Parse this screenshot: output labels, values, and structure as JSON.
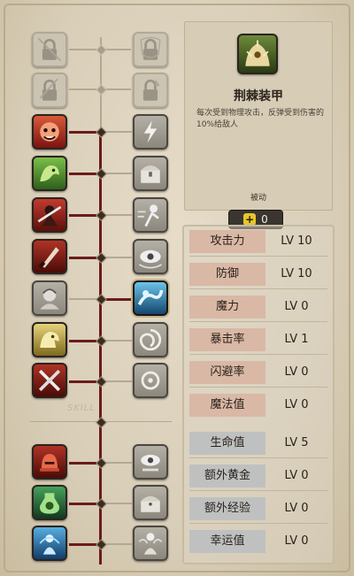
{
  "colors": {
    "background": "#ddd4c1",
    "tree_line": "#6a1b1b",
    "attack_stat_bg": "#d9b8a6",
    "support_stat_bg": "#bfc1c0",
    "points_badge": "#3b3530",
    "plus_icon": "#e7c62d"
  },
  "tree": {
    "left_column": [
      {
        "icon": "locked-sword-icon",
        "state": "locked"
      },
      {
        "icon": "locked-scroll-icon",
        "state": "locked"
      },
      {
        "icon": "red-demon-icon",
        "state": "unlocked"
      },
      {
        "icon": "green-beast-icon",
        "state": "unlocked"
      },
      {
        "icon": "dark-warrior-icon",
        "state": "unlocked"
      },
      {
        "icon": "blade-strike-icon",
        "state": "unlocked"
      },
      {
        "icon": "grey-knight-icon",
        "state": "inactive"
      },
      {
        "icon": "golden-dragon-icon",
        "state": "unlocked"
      },
      {
        "icon": "crossed-swords-icon",
        "state": "unlocked"
      },
      {
        "icon": "red-helmet-icon",
        "state": "unlocked"
      },
      {
        "icon": "green-potion-icon",
        "state": "unlocked"
      },
      {
        "icon": "blue-spirit-icon",
        "state": "unlocked"
      }
    ],
    "right_column": [
      {
        "icon": "locked-shield-icon",
        "state": "locked"
      },
      {
        "icon": "locked-axe-icon",
        "state": "locked"
      },
      {
        "icon": "lightning-fist-icon",
        "state": "inactive"
      },
      {
        "icon": "chest-icon",
        "state": "inactive"
      },
      {
        "icon": "dash-icon",
        "state": "inactive"
      },
      {
        "icon": "wind-eye-icon",
        "state": "inactive"
      },
      {
        "icon": "blue-wave-icon",
        "state": "unlocked"
      },
      {
        "icon": "swirl-icon",
        "state": "inactive"
      },
      {
        "icon": "ring-burst-icon",
        "state": "inactive"
      },
      {
        "icon": "eye-orb-icon",
        "state": "inactive"
      },
      {
        "icon": "treasure-icon",
        "state": "inactive"
      },
      {
        "icon": "angel-icon",
        "state": "inactive"
      }
    ],
    "section_label": "SKILL"
  },
  "detail": {
    "icon": "thorn-armor-icon",
    "title": "荆棘装甲",
    "description": "每次受到物理攻击，反弹受到伤害的10%给敌人",
    "type": "被动"
  },
  "points": {
    "value": "0"
  },
  "stats": [
    {
      "name": "攻击力",
      "level": "LV 10",
      "group": "attack"
    },
    {
      "name": "防御",
      "level": "LV 10",
      "group": "attack"
    },
    {
      "name": "魔力",
      "level": "LV 0",
      "group": "attack"
    },
    {
      "name": "暴击率",
      "level": "LV 1",
      "group": "attack"
    },
    {
      "name": "闪避率",
      "level": "LV 0",
      "group": "attack"
    },
    {
      "name": "魔法值",
      "level": "LV 0",
      "group": "attack"
    },
    {
      "name": "生命值",
      "level": "LV 5",
      "group": "support"
    },
    {
      "name": "额外黄金",
      "level": "LV 0",
      "group": "support"
    },
    {
      "name": "额外经验",
      "level": "LV 0",
      "group": "support"
    },
    {
      "name": "幸运值",
      "level": "LV 0",
      "group": "support"
    }
  ]
}
